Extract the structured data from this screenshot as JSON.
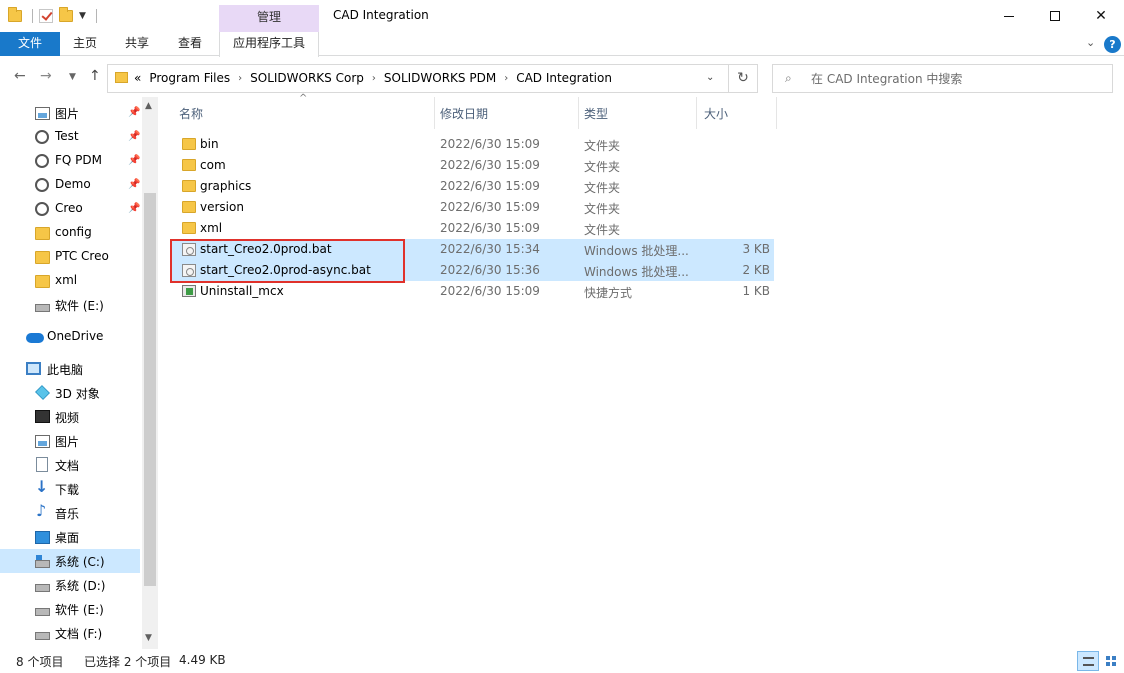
{
  "window": {
    "title": "CAD Integration",
    "context_tab_group": "管理"
  },
  "ribbon": {
    "tabs": [
      "文件",
      "主页",
      "共享",
      "查看",
      "应用程序工具"
    ],
    "help": "?"
  },
  "address": {
    "overflow": "«",
    "crumbs": [
      "Program Files",
      "SOLIDWORKS Corp",
      "SOLIDWORKS PDM",
      "CAD Integration"
    ],
    "search_placeholder": "在 CAD Integration 中搜索"
  },
  "nav": {
    "quick_access": [
      {
        "label": "图片",
        "icon": "pictures-icon",
        "pinned": true
      },
      {
        "label": "Test",
        "icon": "network-folder-icon",
        "pinned": true
      },
      {
        "label": "FQ PDM",
        "icon": "network-folder-icon",
        "pinned": true
      },
      {
        "label": "Demo",
        "icon": "network-folder-icon",
        "pinned": true
      },
      {
        "label": "Creo",
        "icon": "network-folder-icon",
        "pinned": true
      },
      {
        "label": "config",
        "icon": "folder-icon",
        "pinned": false
      },
      {
        "label": "PTC Creo",
        "icon": "folder-icon",
        "pinned": false
      },
      {
        "label": "xml",
        "icon": "folder-icon",
        "pinned": false
      },
      {
        "label": "软件 (E:)",
        "icon": "drive-icon",
        "pinned": false
      }
    ],
    "onedrive": "OneDrive",
    "this_pc": "此电脑",
    "pc_items": [
      {
        "label": "3D 对象",
        "icon": "3d-objects-icon"
      },
      {
        "label": "视频",
        "icon": "videos-icon"
      },
      {
        "label": "图片",
        "icon": "pictures-icon"
      },
      {
        "label": "文档",
        "icon": "documents-icon"
      },
      {
        "label": "下载",
        "icon": "downloads-icon"
      },
      {
        "label": "音乐",
        "icon": "music-icon"
      },
      {
        "label": "桌面",
        "icon": "desktop-icon"
      },
      {
        "label": "系统 (C:)",
        "icon": "system-drive-icon",
        "selected": true
      },
      {
        "label": "系统 (D:)",
        "icon": "drive-icon"
      },
      {
        "label": "软件 (E:)",
        "icon": "drive-icon"
      },
      {
        "label": "文档 (F:)",
        "icon": "drive-icon"
      }
    ]
  },
  "columns": {
    "name": "名称",
    "date": "修改日期",
    "type": "类型",
    "size": "大小"
  },
  "files": [
    {
      "name": "bin",
      "date": "2022/6/30 15:09",
      "type": "文件夹",
      "size": "",
      "icon": "folder-icon",
      "selected": false
    },
    {
      "name": "com",
      "date": "2022/6/30 15:09",
      "type": "文件夹",
      "size": "",
      "icon": "folder-icon",
      "selected": false
    },
    {
      "name": "graphics",
      "date": "2022/6/30 15:09",
      "type": "文件夹",
      "size": "",
      "icon": "folder-icon",
      "selected": false
    },
    {
      "name": "version",
      "date": "2022/6/30 15:09",
      "type": "文件夹",
      "size": "",
      "icon": "folder-icon",
      "selected": false
    },
    {
      "name": "xml",
      "date": "2022/6/30 15:09",
      "type": "文件夹",
      "size": "",
      "icon": "folder-icon",
      "selected": false
    },
    {
      "name": "start_Creo2.0prod.bat",
      "date": "2022/6/30 15:34",
      "type": "Windows 批处理...",
      "size": "3 KB",
      "icon": "batch-file-icon",
      "selected": true
    },
    {
      "name": "start_Creo2.0prod-async.bat",
      "date": "2022/6/30 15:36",
      "type": "Windows 批处理...",
      "size": "2 KB",
      "icon": "batch-file-icon",
      "selected": true
    },
    {
      "name": "Uninstall_mcx",
      "date": "2022/6/30 15:09",
      "type": "快捷方式",
      "size": "1 KB",
      "icon": "shortcut-icon",
      "selected": false
    }
  ],
  "status": {
    "count": "8 个项目",
    "selection": "已选择 2 个项目",
    "selection_size": "4.49 KB"
  },
  "colors": {
    "accent": "#1979ca",
    "selection": "#cce8ff",
    "highlight_box": "#e0312b",
    "manage_tab": "#e8d9f6"
  }
}
